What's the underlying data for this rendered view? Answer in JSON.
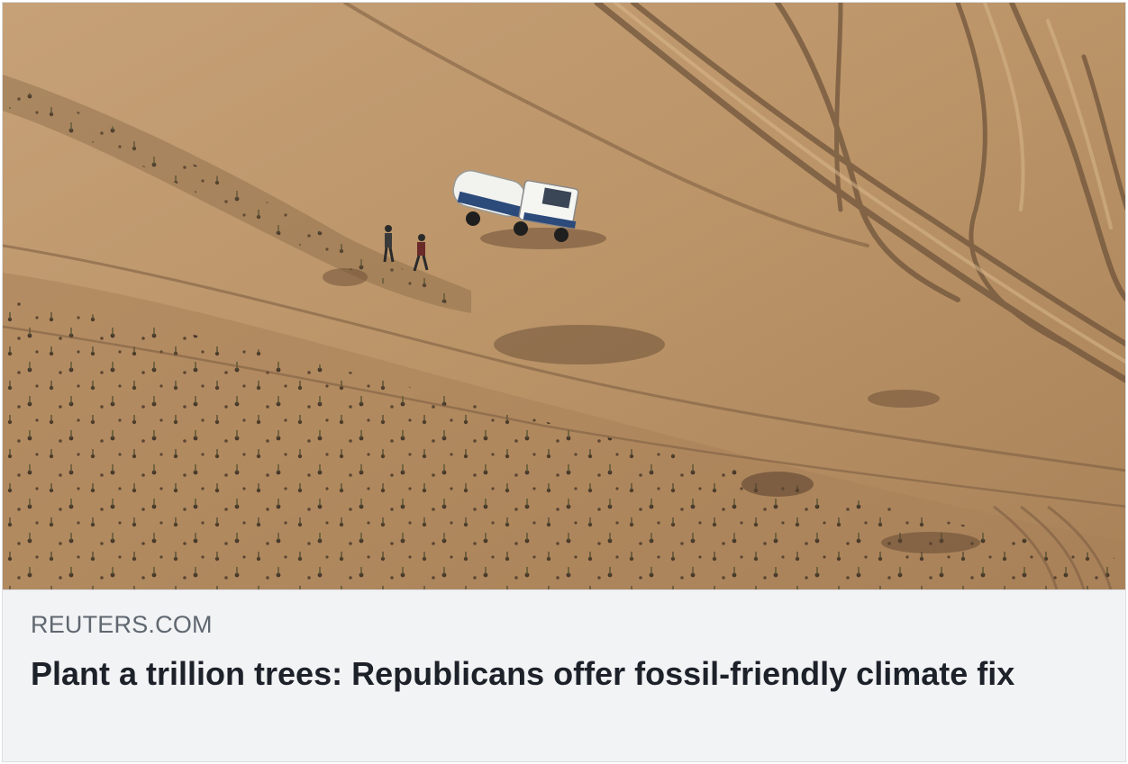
{
  "link_preview": {
    "image_alt": "Aerial view of a water truck and two people on sandy terrain with rows of planted seedlings",
    "source_domain": "REUTERS.COM",
    "headline": "Plant a trillion trees: Republicans offer fossil-friendly climate fix"
  },
  "colors": {
    "caption_background": "#f2f3f5",
    "domain_text": "#606770",
    "headline_text": "#1d2129",
    "border": "#dadde1",
    "sand": "#b99468"
  }
}
